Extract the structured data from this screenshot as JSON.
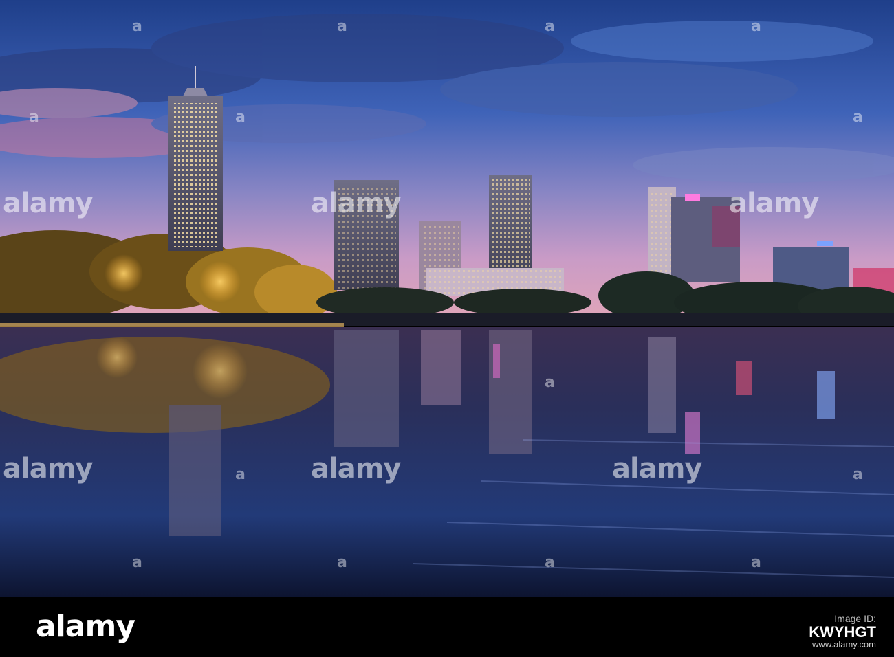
{
  "photo": {
    "subject": "city skyline at dusk reflected in lake"
  },
  "watermark": {
    "text": "alamy",
    "small_mark": "a"
  },
  "footer": {
    "logo": "alamy",
    "image_id": "KWYHGT",
    "image_id_label": "Image ID:",
    "url": "www.alamy.com"
  }
}
